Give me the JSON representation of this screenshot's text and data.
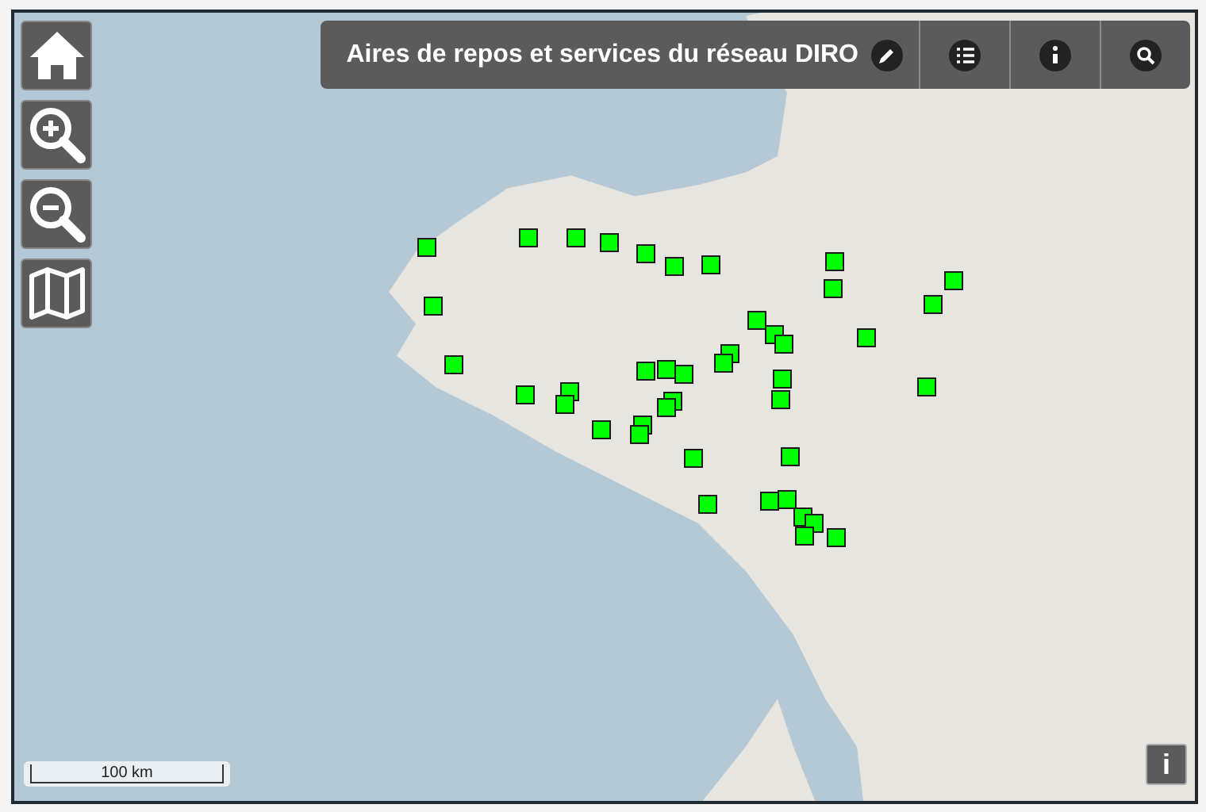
{
  "title_bar": {
    "title": "Aires de repos et services du réseau DIRO"
  },
  "scale_bar": {
    "label": "100 km"
  },
  "attribution_button": {
    "label": "i"
  }
}
